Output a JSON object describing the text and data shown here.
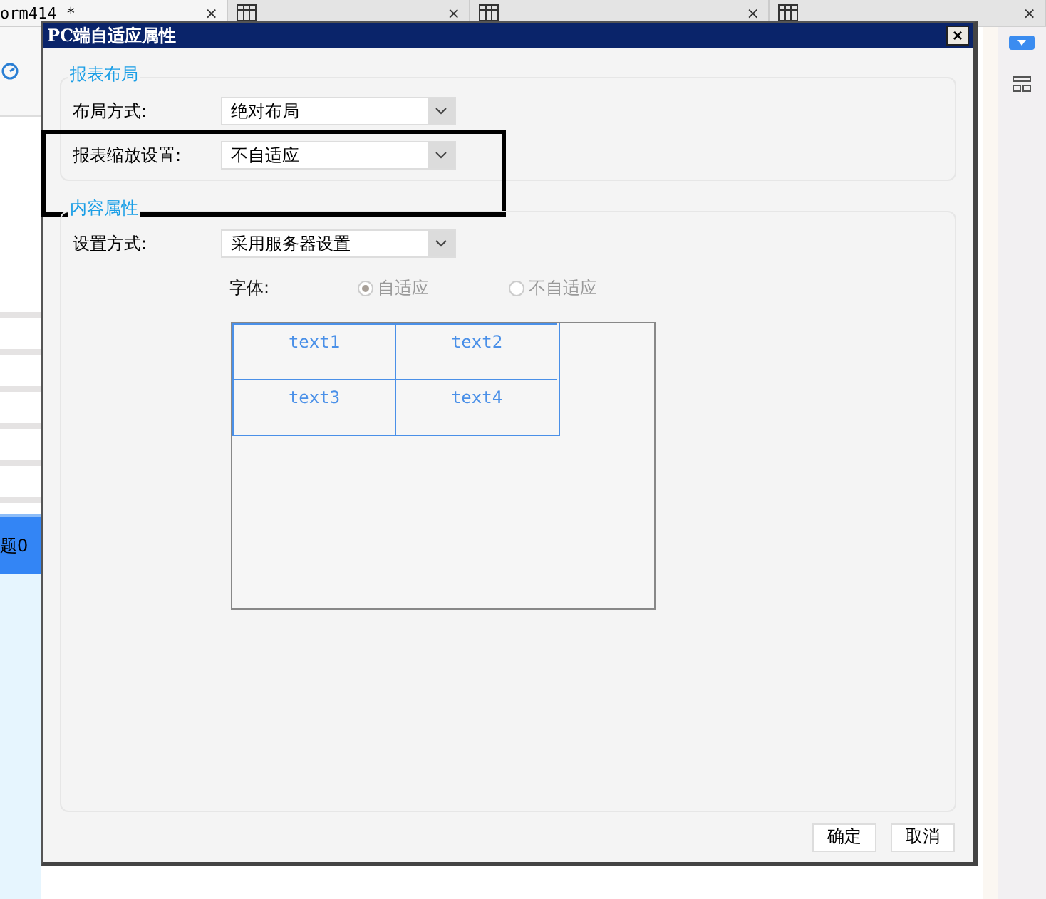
{
  "app": {
    "tabs": [
      {
        "kind": "text",
        "label": "orm414 *",
        "close": "×",
        "selected": true
      },
      {
        "kind": "icon",
        "close": "×",
        "selected": false
      },
      {
        "kind": "icon",
        "close": "×",
        "selected": false
      },
      {
        "kind": "icon",
        "close": "×",
        "selected": false
      }
    ],
    "grid": {
      "highlighted_row": {
        "label": "题0",
        "selected": true
      }
    }
  },
  "dialog": {
    "title": "PC端自适应属性",
    "close": "×",
    "groups": [
      {
        "legend": "报表布局",
        "rows": [
          {
            "label": "布局方式:",
            "value": "绝对布局",
            "highlighted": false
          },
          {
            "label": "报表缩放设置:",
            "value": "不自适应",
            "highlighted": true
          }
        ]
      },
      {
        "legend": "内容属性",
        "rows": [
          {
            "label": "设置方式:",
            "value": "采用服务器设置",
            "highlighted": false
          }
        ],
        "font": {
          "label": "字体:",
          "disabled": true,
          "options": [
            {
              "label": "自适应",
              "selected": true
            },
            {
              "label": "不自适应",
              "selected": false
            }
          ]
        },
        "preview": {
          "cells": [
            "text1",
            "text2",
            "text3",
            "text4"
          ]
        }
      }
    ],
    "buttons": [
      "确定",
      "取消"
    ]
  }
}
